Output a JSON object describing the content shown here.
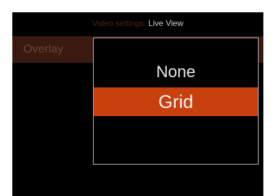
{
  "header": {
    "title_prefix": "Video settings:",
    "title_value": "Live View"
  },
  "menu": {
    "overlay_label": "Overlay"
  },
  "popup": {
    "options": [
      {
        "label": "None"
      },
      {
        "label": "Grid",
        "selected": true
      }
    ],
    "selected_value": "Grid"
  },
  "colors": {
    "highlight": "#c9400f",
    "dimmed_highlight": "#3a1a0f",
    "background": "#000000"
  }
}
